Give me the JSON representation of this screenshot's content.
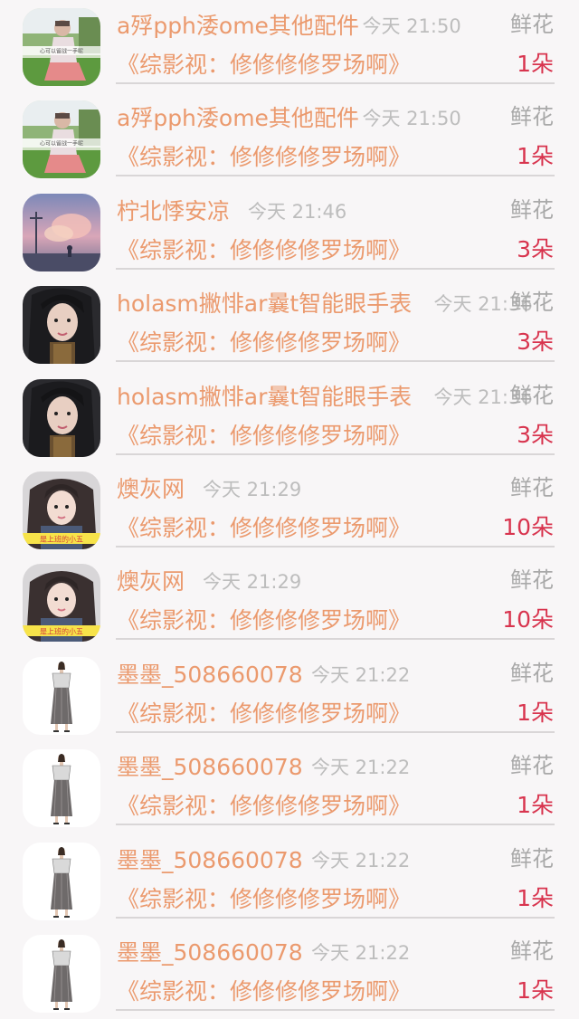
{
  "rows": [
    {
      "name": "a殍pph涹ome其他配件",
      "time": "今天 21:50",
      "gift_label": "鲜花",
      "message": "《综影视：修修修修罗场啊》",
      "count": "1朵",
      "avatar": "girl-field-avatar",
      "avatar_caption": "心可以留战一手呢"
    },
    {
      "name": "a殍pph涹ome其他配件",
      "time": "今天 21:50",
      "gift_label": "鲜花",
      "message": "《综影视：修修修修罗场啊》",
      "count": "1朵",
      "avatar": "girl-field-avatar",
      "avatar_caption": "心可以留战一手呢"
    },
    {
      "name": "柠北悸安凉",
      "time": "今天 21:46",
      "gift_label": "鲜花",
      "message": "《综影视：修修修修罗场啊》",
      "count": "3朵",
      "avatar": "sunset-sky-avatar",
      "avatar_caption": ""
    },
    {
      "name": "holasm撇悱ar曩t智能眼手表",
      "time": "今天 21:36",
      "gift_label": "鲜花",
      "message": "《综影视：修修修修罗场啊》",
      "count": "3朵",
      "avatar": "woman-portrait-avatar",
      "avatar_caption": ""
    },
    {
      "name": "holasm撇悱ar曩t智能眼手表",
      "time": "今天 21:36",
      "gift_label": "鲜花",
      "message": "《综影视：修修修修罗场啊》",
      "count": "3朵",
      "avatar": "woman-portrait-avatar",
      "avatar_caption": ""
    },
    {
      "name": "燠灰网",
      "time": "今天 21:29",
      "gift_label": "鲜花",
      "message": "《综影视：修修修修罗场啊》",
      "count": "10朵",
      "avatar": "girl-selfie-avatar",
      "avatar_caption": "是上班的小五"
    },
    {
      "name": "燠灰网",
      "time": "今天 21:29",
      "gift_label": "鲜花",
      "message": "《综影视：修修修修罗场啊》",
      "count": "10朵",
      "avatar": "girl-selfie-avatar",
      "avatar_caption": "是上班的小五"
    },
    {
      "name": "墨墨_508660078",
      "time": "今天 21:22",
      "gift_label": "鲜花",
      "message": "《综影视：修修修修罗场啊》",
      "count": "1朵",
      "avatar": "fashion-sketch-avatar",
      "avatar_caption": ""
    },
    {
      "name": "墨墨_508660078",
      "time": "今天 21:22",
      "gift_label": "鲜花",
      "message": "《综影视：修修修修罗场啊》",
      "count": "1朵",
      "avatar": "fashion-sketch-avatar",
      "avatar_caption": ""
    },
    {
      "name": "墨墨_508660078",
      "time": "今天 21:22",
      "gift_label": "鲜花",
      "message": "《综影视：修修修修罗场啊》",
      "count": "1朵",
      "avatar": "fashion-sketch-avatar",
      "avatar_caption": ""
    },
    {
      "name": "墨墨_508660078",
      "time": "今天 21:22",
      "gift_label": "鲜花",
      "message": "《综影视：修修修修罗场啊》",
      "count": "1朵",
      "avatar": "fashion-sketch-avatar",
      "avatar_caption": ""
    }
  ],
  "colors": {
    "name": "#eb9a6e",
    "message": "#eb9a6e",
    "time": "#bdbdbd",
    "gift_label": "#a9a9a9",
    "count": "#d8344e",
    "background": "#f8f6f7"
  }
}
